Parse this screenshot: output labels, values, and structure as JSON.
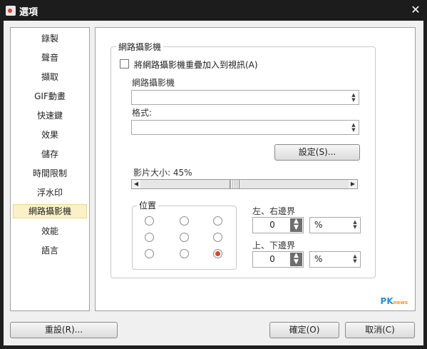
{
  "window": {
    "title": "選項",
    "close_symbol": "✕"
  },
  "sidebar": {
    "items": [
      {
        "label": "錄製"
      },
      {
        "label": "聲音"
      },
      {
        "label": "擷取"
      },
      {
        "label": "GIF動畫"
      },
      {
        "label": "快速鍵"
      },
      {
        "label": "效果"
      },
      {
        "label": "儲存"
      },
      {
        "label": "時間限制"
      },
      {
        "label": "浮水印"
      },
      {
        "label": "網路攝影機",
        "selected": true
      },
      {
        "label": "效能"
      },
      {
        "label": "語言"
      }
    ]
  },
  "webcam": {
    "group_title": "網路攝影機",
    "overlay_checkbox_label": "將網路攝影機重疊加入到視訊(A)",
    "overlay_checked": false,
    "device_label": "網路攝影機",
    "device_value": "",
    "format_label": "格式:",
    "format_value": "",
    "settings_button": "設定(S)...",
    "size_label": "影片大小: 45%",
    "size_percent": 45
  },
  "position": {
    "group_title": "位置",
    "selected": "bottom-right"
  },
  "margins": {
    "horizontal_label": "左、右邊界",
    "horizontal_value": "0",
    "horizontal_unit": "%",
    "vertical_label": "上、下邊界",
    "vertical_value": "0",
    "vertical_unit": "%"
  },
  "footer": {
    "reset_button": "重設(R)...",
    "ok_button": "確定(O)",
    "cancel_button": "取消(C)"
  },
  "watermark": {
    "brand": "PK",
    "sub": "news"
  }
}
